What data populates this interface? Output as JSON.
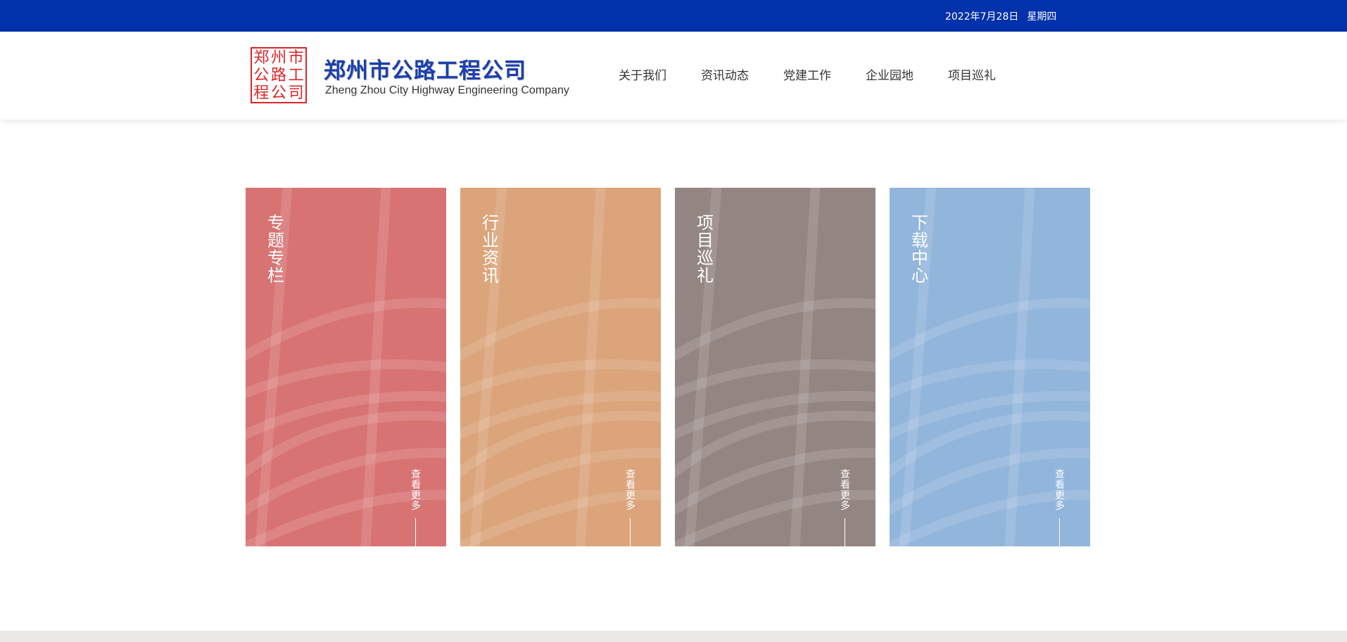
{
  "topbar": {
    "date": "2022年7月28日",
    "weekday": "星期四"
  },
  "brand": {
    "seal_chars": [
      "郑",
      "州",
      "市",
      "公",
      "路",
      "工",
      "程",
      "公",
      "司"
    ],
    "name_cn": "郑州市公路工程公司",
    "name_en": "Zheng Zhou City Highway Engineering Company"
  },
  "nav": {
    "items": [
      {
        "label": "关于我们"
      },
      {
        "label": "资讯动态"
      },
      {
        "label": "党建工作"
      },
      {
        "label": "企业园地"
      },
      {
        "label": "项目巡礼"
      }
    ]
  },
  "cards": [
    {
      "title": "专题专栏",
      "more": "查看更多",
      "color": "#d87373"
    },
    {
      "title": "行业资讯",
      "more": "查看更多",
      "color": "#dba47a"
    },
    {
      "title": "项目巡礼",
      "more": "查看更多",
      "color": "#938581"
    },
    {
      "title": "下载中心",
      "more": "查看更多",
      "color": "#92b5db"
    }
  ]
}
